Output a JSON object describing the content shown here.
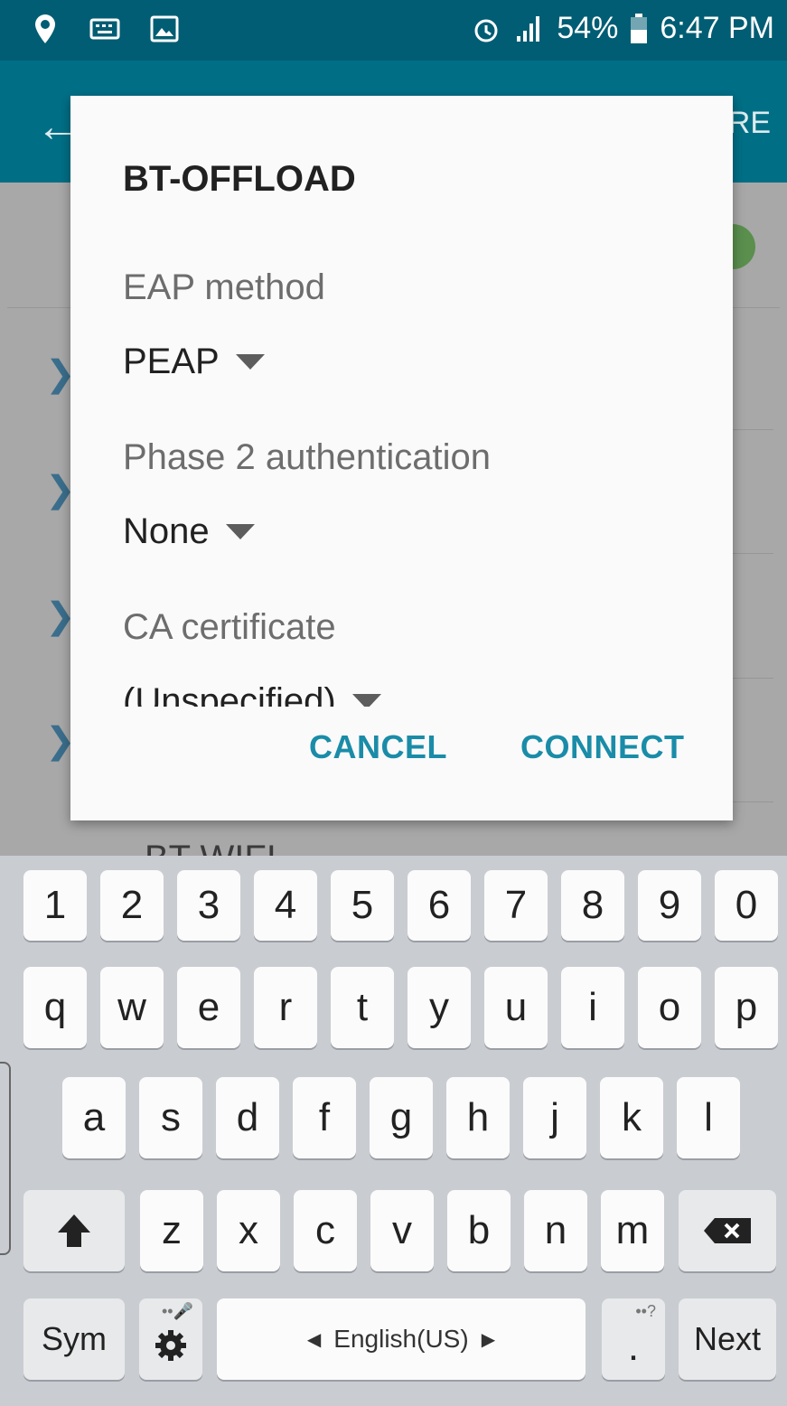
{
  "status_bar": {
    "time": "6:47 PM",
    "battery": "54%",
    "left_icons": [
      "location-pin-icon",
      "keyboard-icon",
      "image-icon"
    ],
    "right_icons": [
      "alarm-icon",
      "signal-icon",
      "battery-icon"
    ]
  },
  "app_bar": {
    "more_label": "RE"
  },
  "dialog": {
    "title": "BT-OFFLOAD",
    "fields": [
      {
        "label": "EAP method",
        "value": "PEAP"
      },
      {
        "label": "Phase 2 authentication",
        "value": "None"
      },
      {
        "label": "CA certificate",
        "value": "(Unspecified)"
      }
    ],
    "cancel_label": "CANCEL",
    "connect_label": "CONNECT"
  },
  "background_list": {
    "partial_item": "BT WIFI"
  },
  "keyboard": {
    "row_numbers": [
      "1",
      "2",
      "3",
      "4",
      "5",
      "6",
      "7",
      "8",
      "9",
      "0"
    ],
    "row_q": [
      "q",
      "w",
      "e",
      "r",
      "t",
      "y",
      "u",
      "i",
      "o",
      "p"
    ],
    "row_a": [
      "a",
      "s",
      "d",
      "f",
      "g",
      "h",
      "j",
      "k",
      "l"
    ],
    "row_z": [
      "z",
      "x",
      "c",
      "v",
      "b",
      "n",
      "m"
    ],
    "sym_label": "Sym",
    "language_label": "English(US)",
    "period_key": ".",
    "period_hint": "••?",
    "next_label": "Next"
  },
  "colors": {
    "status_bar": "#005d73",
    "app_bar": "#006f86",
    "accent": "#1a8ca8"
  }
}
